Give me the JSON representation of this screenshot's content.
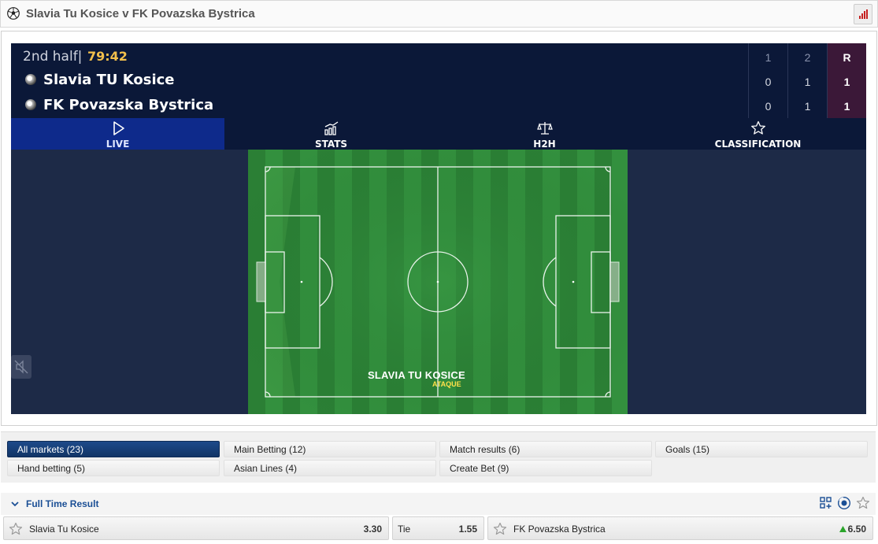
{
  "header": {
    "title": "Slavia Tu Kosice v FK Povazska Bystrica",
    "ball_icon": "soccer-ball-icon",
    "stats_icon": "bar-chart-icon"
  },
  "scoreboard": {
    "phase": "2nd half|",
    "clock": "79:42",
    "columns": [
      "1",
      "2",
      "R"
    ],
    "teams": [
      {
        "name": "Slavia TU Kosice",
        "scores": [
          "0",
          "1",
          "1"
        ]
      },
      {
        "name": "FK Povazska Bystrica",
        "scores": [
          "0",
          "1",
          "1"
        ]
      }
    ]
  },
  "tabs": [
    {
      "label": "LIVE",
      "icon": "play-icon",
      "active": true
    },
    {
      "label": "STATS",
      "icon": "stats-icon",
      "active": false
    },
    {
      "label": "H2H",
      "icon": "scale-icon",
      "active": false
    },
    {
      "label": "CLASSIFICATION",
      "icon": "star-badge-icon",
      "active": false
    }
  ],
  "pitch": {
    "team_label": "SLAVIA TU KOSICE",
    "action_label": "ATAQUE"
  },
  "markets": {
    "filters": [
      {
        "label": "All markets (23)",
        "active": true
      },
      {
        "label": "Main Betting (12)",
        "active": false
      },
      {
        "label": "Match results (6)",
        "active": false
      },
      {
        "label": "Goals (15)",
        "active": false
      },
      {
        "label": "Hand betting (5)",
        "active": false
      },
      {
        "label": "Asian Lines (4)",
        "active": false
      },
      {
        "label": "Create Bet (9)",
        "active": false
      }
    ]
  },
  "full_time_result": {
    "title": "Full Time Result",
    "options": [
      {
        "name": "Slavia Tu Kosice",
        "price": "3.30"
      },
      {
        "name": "Tie",
        "price": "1.55"
      },
      {
        "name": "FK Povazska Bystrica",
        "price": "6.50",
        "trend": "up"
      }
    ]
  },
  "colors": {
    "scoreboard_bg": "#0b1838",
    "tab_active_bg": "#0e2a8b",
    "clock": "#f3c04c",
    "result_col_bg": "#3b1838",
    "pitch_green": "#2e8b3a",
    "market_active": "#1d4a8a",
    "link_blue": "#1b4f95",
    "trend_up": "#2aa52a"
  }
}
